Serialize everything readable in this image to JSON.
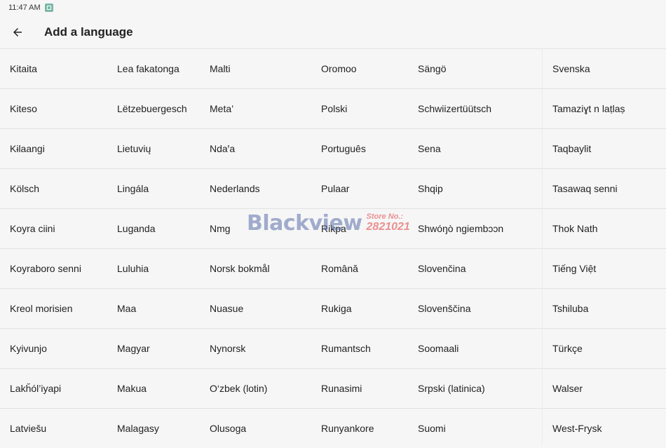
{
  "status_bar": {
    "time": "11:47 AM",
    "icons": [
      "notification-icon"
    ]
  },
  "app_bar": {
    "back_icon": "arrow-left-icon",
    "title": "Add a language"
  },
  "languages": [
    [
      "Kitaita",
      "Lea fakatonga",
      "Malti",
      "Oromoo",
      "Sängö",
      "Svenska"
    ],
    [
      "Kiteso",
      "Lëtzebuergesch",
      "Meta’",
      "Polski",
      "Schwiizertüütsch",
      "Tamaziɣt n laṭlaṣ"
    ],
    [
      "Kɨlaangi",
      "Lietuvių",
      "Ndaꞌa",
      "Português",
      "Sena",
      "Taqbaylit"
    ],
    [
      "Kölsch",
      "Lingála",
      "Nederlands",
      "Pulaar",
      "Shqip",
      "Tasawaq senni"
    ],
    [
      "Koyra ciini",
      "Luganda",
      "Nmg",
      "Rikpa",
      "Shwóŋò ngiembɔɔn",
      "Thok Nath"
    ],
    [
      "Koyraboro senni",
      "Luluhia",
      "Norsk bokmål",
      "Română",
      "Slovenčina",
      "Tiếng Việt"
    ],
    [
      "Kreol morisien",
      "Maa",
      "Nuasue",
      "Rukiga",
      "Slovenščina",
      "Tshiluba"
    ],
    [
      "Kyivunjo",
      "Magyar",
      "Nynorsk",
      "Rumantsch",
      "Soomaali",
      "Türkçe"
    ],
    [
      "Lakȟól’iyapi",
      "Makua",
      "O‘zbek (lotin)",
      "Runasimi",
      "Srpski (latinica)",
      "Walser"
    ],
    [
      "Latviešu",
      "Malagasy",
      "Olusoga",
      "Runyankore",
      "Suomi",
      "West-Frysk"
    ]
  ],
  "watermark": {
    "brand": "Blackview",
    "store_label": "Store No.:",
    "store_number": "2821021"
  },
  "colors": {
    "background": "#f6f6f6",
    "divider": "#e2e2e2",
    "text": "#222222"
  }
}
